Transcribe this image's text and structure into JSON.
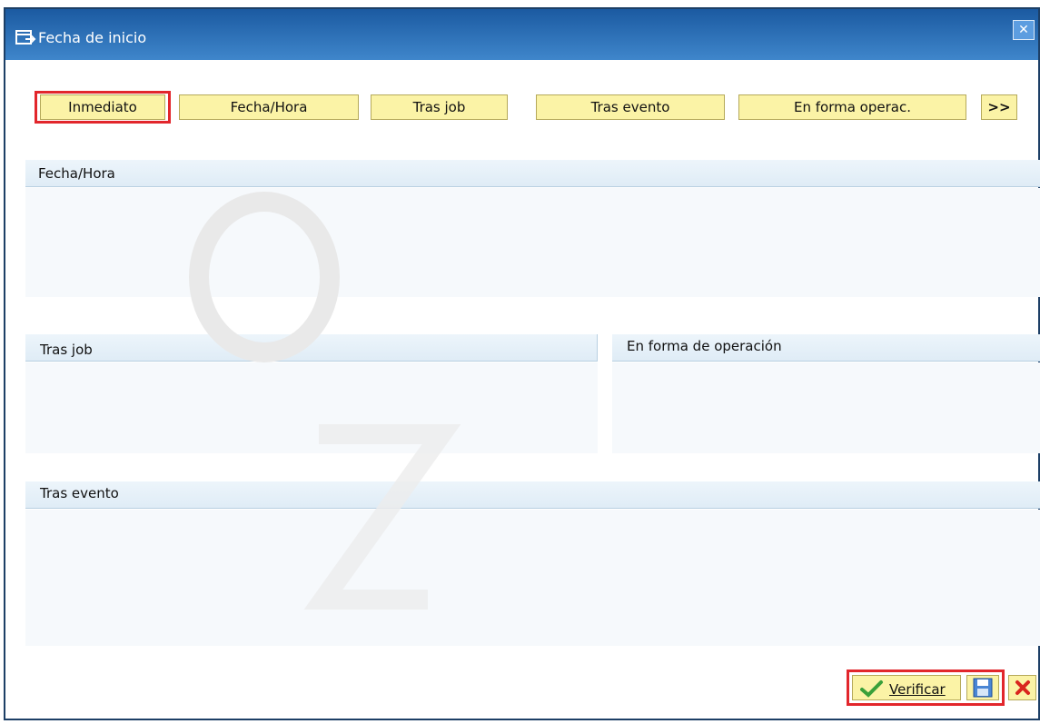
{
  "window": {
    "title": "Fecha de inicio",
    "close_label": "✕"
  },
  "toolbar": {
    "buttons": [
      {
        "label": "Inmediato"
      },
      {
        "label": "Fecha/Hora"
      },
      {
        "label": "Tras job"
      },
      {
        "label": "Tras evento"
      },
      {
        "label": "En forma operac."
      },
      {
        "label": ">>"
      }
    ]
  },
  "sections": {
    "fecha_hora": "Fecha/Hora",
    "tras_job": "Tras job",
    "en_forma": "En forma de operación",
    "tras_evento": "Tras evento"
  },
  "footer": {
    "verify_label": "Verificar"
  },
  "colors": {
    "button_bg": "#fbf3a6",
    "highlight": "#e2262c",
    "titlebar": "#1b5aa1"
  }
}
